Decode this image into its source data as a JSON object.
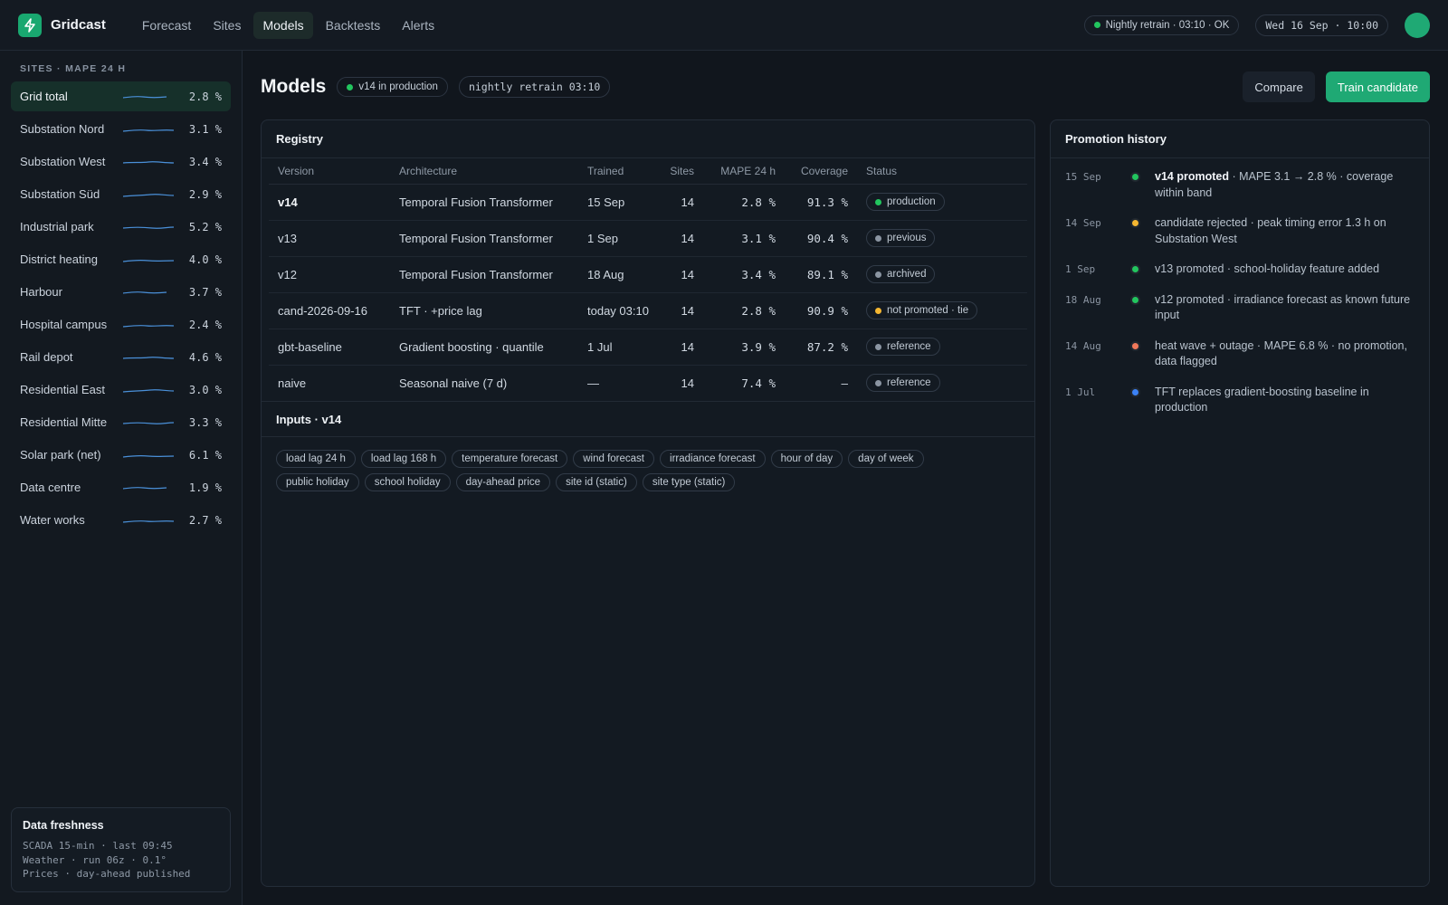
{
  "app": {
    "name": "Gridcast"
  },
  "nav": [
    {
      "label": "Forecast",
      "active": false
    },
    {
      "label": "Sites",
      "active": false
    },
    {
      "label": "Models",
      "active": true
    },
    {
      "label": "Backtests",
      "active": false
    },
    {
      "label": "Alerts",
      "active": false
    }
  ],
  "status": {
    "retrain": "Nightly retrain · 03:10 · OK",
    "datetime": "Wed 16 Sep · 10:00"
  },
  "sidebar": {
    "header": "SITES · MAPE 24 H",
    "sites": [
      {
        "name": "Grid total",
        "value": "2.8 %",
        "active": true
      },
      {
        "name": "Substation Nord",
        "value": "3.1 %"
      },
      {
        "name": "Substation West",
        "value": "3.4 %"
      },
      {
        "name": "Substation Süd",
        "value": "2.9 %"
      },
      {
        "name": "Industrial park",
        "value": "5.2 %"
      },
      {
        "name": "District heating",
        "value": "4.0 %"
      },
      {
        "name": "Harbour",
        "value": "3.7 %"
      },
      {
        "name": "Hospital campus",
        "value": "2.4 %"
      },
      {
        "name": "Rail depot",
        "value": "4.6 %"
      },
      {
        "name": "Residential East",
        "value": "3.0 %"
      },
      {
        "name": "Residential Mitte",
        "value": "3.3 %"
      },
      {
        "name": "Solar park (net)",
        "value": "6.1 %"
      },
      {
        "name": "Data centre",
        "value": "1.9 %"
      },
      {
        "name": "Water works",
        "value": "2.7 %"
      }
    ],
    "freshness": {
      "title": "Data freshness",
      "lines": [
        "SCADA 15-min · last 09:45",
        "Weather · run 06z · 0.1°",
        "Prices · day-ahead published"
      ]
    }
  },
  "page": {
    "title": "Models",
    "prod_pill": "v14 in production",
    "retrain_pill": "nightly retrain 03:10",
    "compare_label": "Compare",
    "train_label": "Train candidate"
  },
  "registry": {
    "title": "Registry",
    "columns": [
      "Version",
      "Architecture",
      "Trained",
      "Sites",
      "MAPE 24 h",
      "Coverage",
      "Status"
    ],
    "rows": [
      {
        "version": "v14",
        "arch": "Temporal Fusion Transformer",
        "trained": "15 Sep",
        "sites": "14",
        "mape": "2.8 %",
        "coverage": "91.3 %",
        "status": "production",
        "status_color": "#22c55e",
        "bold": true
      },
      {
        "version": "v13",
        "arch": "Temporal Fusion Transformer",
        "trained": "1 Sep",
        "sites": "14",
        "mape": "3.1 %",
        "coverage": "90.4 %",
        "status": "previous",
        "status_color": "#8b95a2"
      },
      {
        "version": "v12",
        "arch": "Temporal Fusion Transformer",
        "trained": "18 Aug",
        "sites": "14",
        "mape": "3.4 %",
        "coverage": "89.1 %",
        "status": "archived",
        "status_color": "#8b95a2"
      },
      {
        "version": "cand-2026-09-16",
        "arch": "TFT · +price lag",
        "trained": "today 03:10",
        "sites": "14",
        "mape": "2.8 %",
        "coverage": "90.9 %",
        "status": "not promoted · tie",
        "status_color": "#f5b731"
      },
      {
        "version": "gbt-baseline",
        "arch": "Gradient boosting · quantile",
        "trained": "1 Jul",
        "sites": "14",
        "mape": "3.9 %",
        "coverage": "87.2 %",
        "status": "reference",
        "status_color": "#8b95a2"
      },
      {
        "version": "naive",
        "arch": "Seasonal naive (7 d)",
        "trained": "—",
        "sites": "14",
        "mape": "7.4 %",
        "coverage": "–",
        "status": "reference",
        "status_color": "#8b95a2"
      }
    ]
  },
  "inputs": {
    "title": "Inputs · v14",
    "chips": [
      "load lag 24 h",
      "load lag 168 h",
      "temperature forecast",
      "wind forecast",
      "irradiance forecast",
      "hour of day",
      "day of week",
      "public holiday",
      "school holiday",
      "day-ahead price",
      "site id (static)",
      "site type (static)"
    ]
  },
  "history": {
    "title": "Promotion history",
    "events": [
      {
        "date": "15 Sep",
        "color": "#22c55e",
        "lead": "v14 promoted",
        "text": " · MAPE 3.1 → 2.8 % · coverage within band"
      },
      {
        "date": "14 Sep",
        "color": "#f5b731",
        "lead": "",
        "text": "candidate rejected · peak timing error 1.3 h on Substation West"
      },
      {
        "date": "1 Sep",
        "color": "#22c55e",
        "lead": "",
        "text": "v13 promoted · school-holiday feature added"
      },
      {
        "date": "18 Aug",
        "color": "#22c55e",
        "lead": "",
        "text": "v12 promoted · irradiance forecast as known future input"
      },
      {
        "date": "14 Aug",
        "color": "#f0785a",
        "lead": "",
        "text": "heat wave + outage · MAPE 6.8 % · no promotion, data flagged"
      },
      {
        "date": "1 Jul",
        "color": "#3b82f6",
        "lead": "",
        "text": "TFT replaces gradient-boosting baseline in production"
      }
    ]
  }
}
